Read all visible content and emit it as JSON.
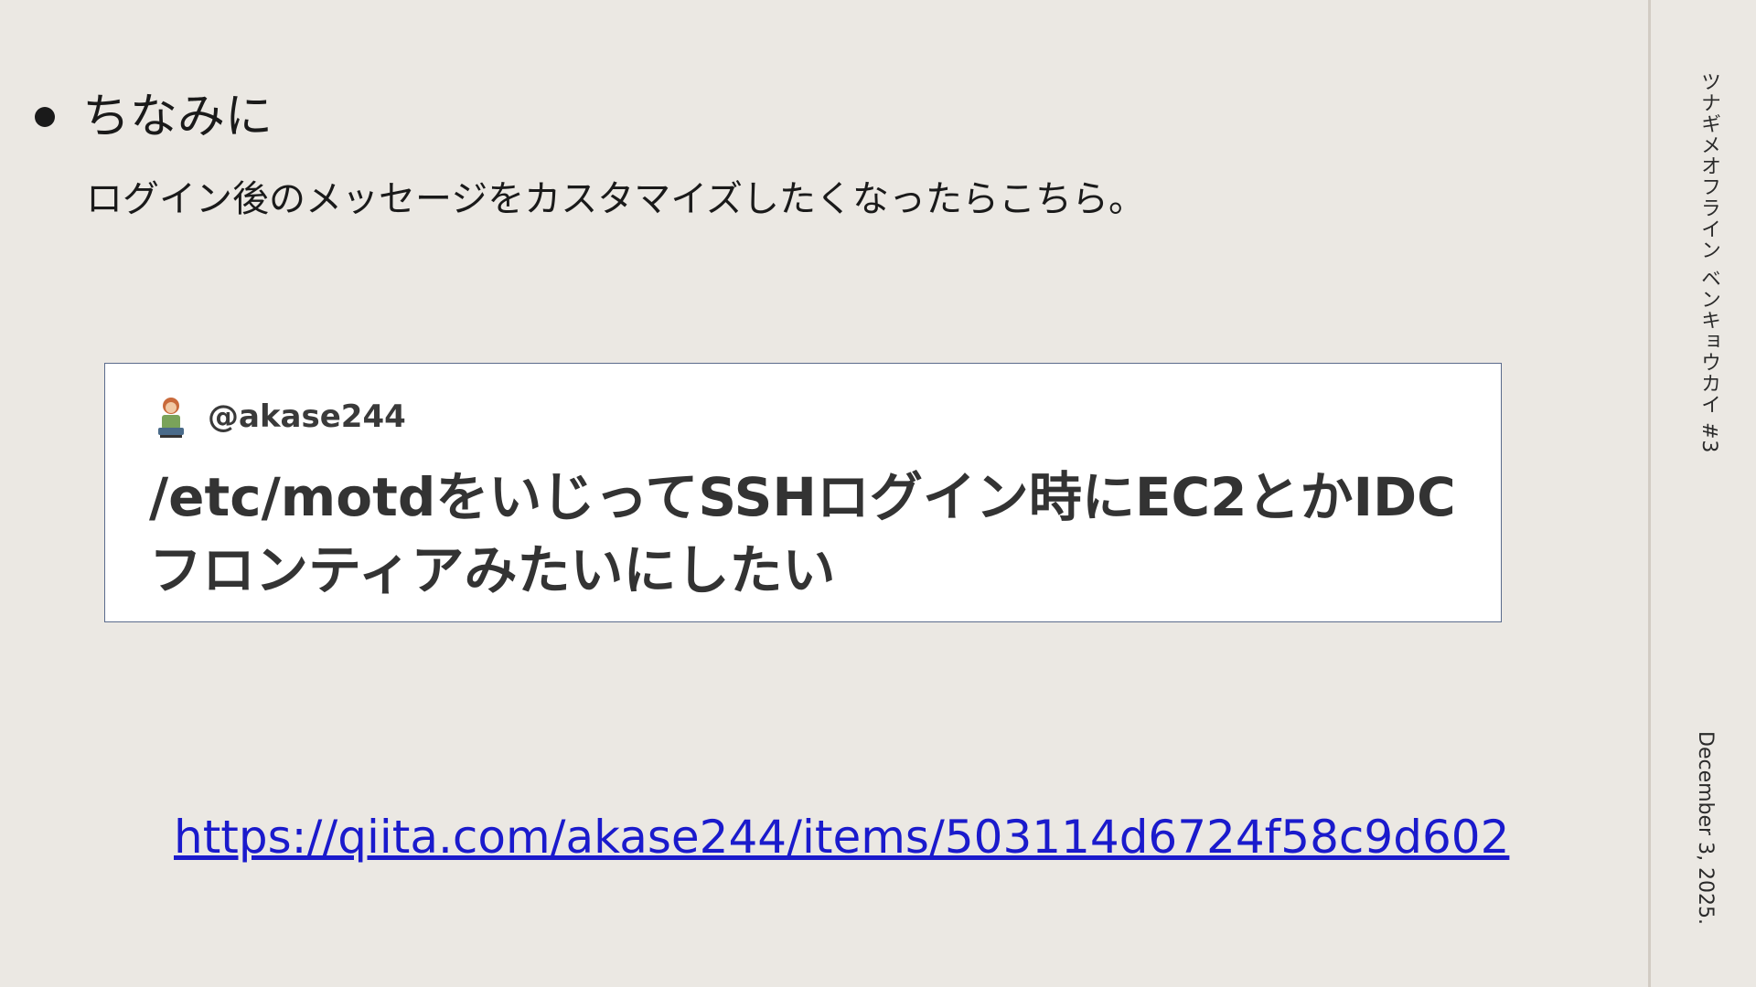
{
  "slide": {
    "bullet": "ちなみに",
    "subtext": "ログイン後のメッセージをカスタマイズしたくなったらこちら。",
    "card": {
      "username": "@akase244",
      "title": "/etc/motdをいじってSSHログイン時にEC2とかIDCフロンティアみたいにしたい"
    },
    "link": "https://qiita.com/akase244/items/503114d6724f58c9d602"
  },
  "side": {
    "event_title": "ツナギメオフライン ベンキョウカイ #3",
    "date": "December 3, 2025."
  },
  "colors": {
    "background": "#ebe8e3",
    "link": "#1a1acc",
    "card_border": "#5b6b8c"
  }
}
